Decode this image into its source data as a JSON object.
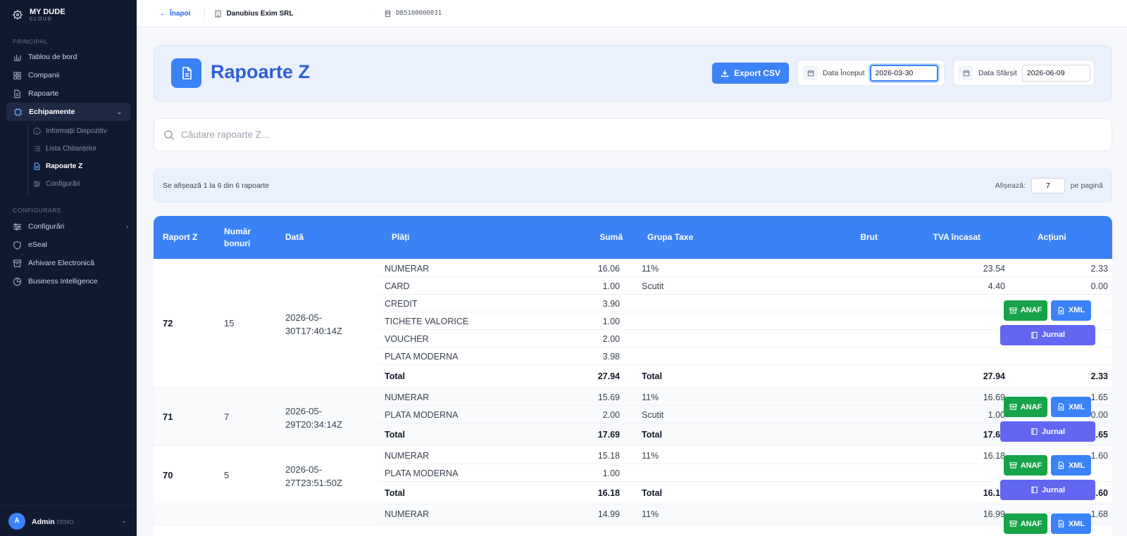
{
  "brand": {
    "name": "MY DUDE",
    "sub": "CLOUD"
  },
  "sidebar": {
    "section_principal": "PRINCIPAL",
    "section_config": "CONFIGURARE",
    "items": [
      {
        "label": "Tablou de bord"
      },
      {
        "label": "Companii"
      },
      {
        "label": "Rapoarte"
      },
      {
        "label": "Echipamente"
      }
    ],
    "subitems": [
      {
        "label": "Informații Dispozitiv"
      },
      {
        "label": "Lista Chitanțelor"
      },
      {
        "label": "Rapoarte Z"
      },
      {
        "label": "Configurări"
      }
    ],
    "config_items": [
      {
        "label": "Configurări"
      },
      {
        "label": "eSeal"
      },
      {
        "label": "Arhivare Electronică"
      },
      {
        "label": "Business Intelligence"
      }
    ],
    "user": {
      "initial": "A",
      "name": "Admin",
      "role": "DEMO"
    }
  },
  "topbar": {
    "back_label": "Înapoi",
    "company": "Danubius Exim SRL",
    "separator": "·",
    "serial": "DB5100000031"
  },
  "header": {
    "title": "Rapoarte Z",
    "export_label": "Export CSV",
    "start_label": "Data Început",
    "start_value": "2026-03-30",
    "end_label": "Data Sfârșit",
    "end_value": "2026-06-09"
  },
  "search": {
    "placeholder": "Căutare rapoarte Z..."
  },
  "info": {
    "showing": "Se afișează 1 la 6 din 6 rapoarte",
    "per_page_prefix": "Afișează:",
    "per_page_value": "7",
    "per_page_suffix": "pe pagină"
  },
  "table": {
    "headers": {
      "raport": "Raport Z",
      "bonuri": "Număr bonuri",
      "data": "Dată",
      "plati": "Plăți",
      "suma": "Sumă",
      "grupa": "Grupa Taxe",
      "brut": "Brut",
      "tva": "TVA încasat",
      "actiuni": "Acțiuni"
    },
    "actions": {
      "anaf": "ANAF",
      "xml": "XML",
      "jurnal": "Jurnal"
    },
    "rows": [
      {
        "raport": "72",
        "bonuri": "15",
        "date1": "2026-05-",
        "date2": "30T17:40:14Z",
        "lines": [
          {
            "plata": "NUMERAR",
            "suma": "16.06",
            "grupa": "11%",
            "brut": "23.54",
            "tva": "2.33"
          },
          {
            "plata": "CARD",
            "suma": "1.00",
            "grupa": "Scutit",
            "brut": "4.40",
            "tva": "0.00"
          },
          {
            "plata": "CREDIT",
            "suma": "3.90",
            "grupa": "",
            "brut": "",
            "tva": ""
          },
          {
            "plata": "TICHETE VALORICE",
            "suma": "1.00",
            "grupa": "",
            "brut": "",
            "tva": ""
          },
          {
            "plata": "VOUCHER",
            "suma": "2.00",
            "grupa": "",
            "brut": "",
            "tva": ""
          },
          {
            "plata": "PLATA MODERNA",
            "suma": "3.98",
            "grupa": "",
            "brut": "",
            "tva": ""
          },
          {
            "plata": "Total",
            "suma": "27.94",
            "grupa": "Total",
            "brut": "27.94",
            "tva": "2.33"
          }
        ]
      },
      {
        "raport": "71",
        "bonuri": "7",
        "date1": "2026-05-",
        "date2": "29T20:34:14Z",
        "lines": [
          {
            "plata": "NUMERAR",
            "suma": "15.69",
            "grupa": "11%",
            "brut": "16.69",
            "tva": "1.65"
          },
          {
            "plata": "PLATA MODERNA",
            "suma": "2.00",
            "grupa": "Scutit",
            "brut": "1.00",
            "tva": "0.00"
          },
          {
            "plata": "Total",
            "suma": "17.69",
            "grupa": "Total",
            "brut": "17.69",
            "tva": "1.65"
          }
        ]
      },
      {
        "raport": "70",
        "bonuri": "5",
        "date1": "2026-05-",
        "date2": "27T23:51:50Z",
        "lines": [
          {
            "plata": "NUMERAR",
            "suma": "15.18",
            "grupa": "11%",
            "brut": "16.18",
            "tva": "1.60"
          },
          {
            "plata": "PLATA MODERNA",
            "suma": "1.00",
            "grupa": "",
            "brut": "",
            "tva": ""
          },
          {
            "plata": "Total",
            "suma": "16.18",
            "grupa": "Total",
            "brut": "16.18",
            "tva": "1.60"
          }
        ]
      },
      {
        "raport": "",
        "bonuri": "",
        "date1": "",
        "date2": "",
        "lines": [
          {
            "plata": "NUMERAR",
            "suma": "14.99",
            "grupa": "11%",
            "brut": "16.99",
            "tva": "1.68"
          }
        ]
      }
    ]
  }
}
